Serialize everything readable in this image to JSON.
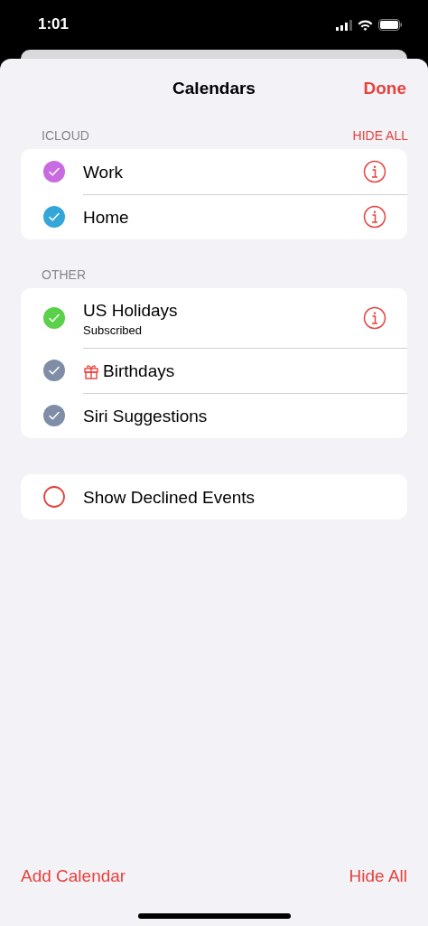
{
  "status_bar": {
    "time": "1:01"
  },
  "nav": {
    "title": "Calendars",
    "done": "Done"
  },
  "sections": [
    {
      "header": "ICLOUD",
      "action": "HIDE ALL",
      "rows": [
        {
          "kind": "calendar",
          "label": "Work",
          "checked": true,
          "color": "#c86ae0",
          "info": true
        },
        {
          "kind": "calendar",
          "label": "Home",
          "checked": true,
          "color": "#35a6da",
          "info": true
        }
      ]
    },
    {
      "header": "OTHER",
      "rows": [
        {
          "kind": "calendar",
          "label": "US Holidays",
          "subtitle": "Subscribed",
          "checked": true,
          "color": "#5bd04a",
          "info": true
        },
        {
          "kind": "birthday",
          "label": "Birthdays",
          "checked": true,
          "color": "#7f8ea6",
          "info": false
        },
        {
          "kind": "calendar",
          "label": "Siri Suggestions",
          "checked": true,
          "color": "#7f8ea6",
          "info": false
        }
      ]
    },
    {
      "rows": [
        {
          "kind": "calendar",
          "label": "Show Declined Events",
          "checked": false,
          "color": "#e8413c",
          "info": false
        }
      ]
    }
  ],
  "footer": {
    "left": "Add Calendar",
    "right": "Hide All"
  }
}
